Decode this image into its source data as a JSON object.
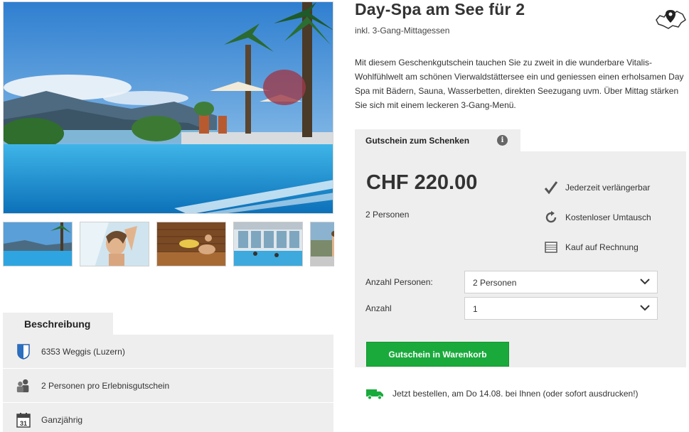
{
  "product": {
    "title": "Day-Spa am See für 2",
    "subtitle": "inkl. 3-Gang-Mittagessen",
    "intro": "Mit diesem Geschenkgutschein tauchen Sie zu zweit in die wunderbare Vitalis-Wohlfühlwelt am schönen Vierwaldstättersee ein und geniessen einen erholsamen Day Spa mit Bädern, Sauna, Wasserbetten, direkten Seezugang uvm. Über Mittag stärken Sie sich mit einem leckeren 3-Gang-Menü."
  },
  "gallery": {
    "main_icon": "pool-lake-photo",
    "thumbnails": [
      {
        "icon": "pool-photo"
      },
      {
        "icon": "woman-shower-photo"
      },
      {
        "icon": "sauna-photo"
      },
      {
        "icon": "indoor-pool-photo"
      },
      {
        "icon": "terrace-photo"
      }
    ]
  },
  "description": {
    "tab_label": "Beschreibung",
    "rows": [
      {
        "icon": "canton-shield-icon",
        "text": "6353 Weggis (Luzern)"
      },
      {
        "icon": "people-icon",
        "text": "2 Personen pro Erlebnisgutschein"
      },
      {
        "icon": "calendar-icon",
        "text": "Ganzjährig"
      }
    ],
    "calendar_number": "31"
  },
  "voucher": {
    "tab_label": "Gutschein zum Schenken",
    "info_glyph": "i",
    "price": "CHF 220.00",
    "persons": "2 Personen",
    "features": [
      {
        "icon": "checkmark-icon",
        "text": "Jederzeit verlängerbar"
      },
      {
        "icon": "refresh-icon",
        "text": "Kostenloser Umtausch"
      },
      {
        "icon": "invoice-icon",
        "text": "Kauf auf Rechnung"
      }
    ],
    "persons_select": {
      "label": "Anzahl Personen:",
      "value": "2 Personen"
    },
    "quantity_select": {
      "label": "Anzahl",
      "value": "1"
    },
    "cart_button": "Gutschein in Warenkorb"
  },
  "delivery": {
    "icon": "truck-icon",
    "text": "Jetzt bestellen, am Do 14.08. bei Ihnen (oder sofort ausdrucken!)"
  },
  "colors": {
    "accent_green": "#1aaa3c",
    "panel_gray": "#eeeeee",
    "text_dark": "#333333"
  }
}
